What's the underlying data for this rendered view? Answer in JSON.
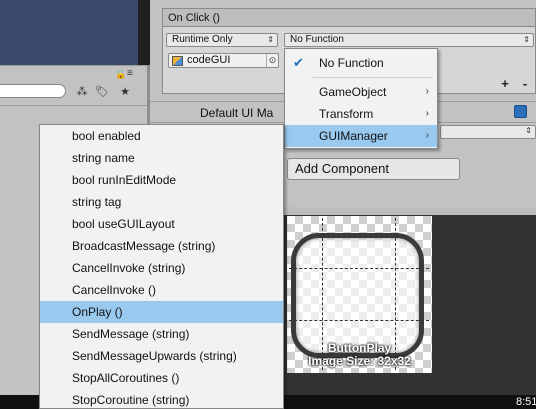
{
  "onclick": {
    "header": "On Click ()",
    "runtime_select": "Runtime Only",
    "function_select": "No Function",
    "object_field": "codeGUI",
    "plus": "+",
    "minus": "-"
  },
  "inspector": {
    "default_label": "Default UI Ma",
    "add_component": "Add Component"
  },
  "preview": {
    "sprite_name": "ButtonPlay",
    "image_size": "Image Size: 32x32"
  },
  "clock": "8:51",
  "function_menu": {
    "items": [
      {
        "label": "No Function",
        "checked": true,
        "submenu": false
      },
      {
        "label": "GameObject",
        "checked": false,
        "submenu": true
      },
      {
        "label": "Transform",
        "checked": false,
        "submenu": true
      },
      {
        "label": "GUIManager",
        "checked": false,
        "submenu": true,
        "highlighted": true
      }
    ],
    "submenu_arrow": "›"
  },
  "method_menu": {
    "items": [
      "bool enabled",
      "string name",
      "bool runInEditMode",
      "string tag",
      "bool useGUILayout",
      "BroadcastMessage (string)",
      "CancelInvoke (string)",
      "CancelInvoke ()",
      "OnPlay ()",
      "SendMessage (string)",
      "SendMessageUpwards (string)",
      "StopAllCoroutines ()",
      "StopCoroutine (string)"
    ],
    "highlighted_index": 8
  },
  "icons": {
    "check": "✔",
    "dropdown": "⇕",
    "picker": "⊙",
    "lock": "🔒",
    "gear": "⚙",
    "tag": "🏷",
    "star": "★"
  },
  "colors": {
    "highlight": "#99c9ef",
    "check": "#1f6fc5"
  }
}
